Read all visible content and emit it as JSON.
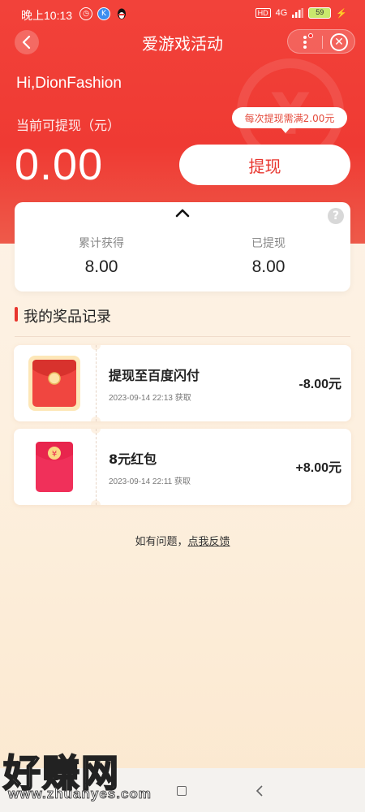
{
  "status_bar": {
    "time": "晚上10:13",
    "network": "4G",
    "battery": "59",
    "hd": "HD"
  },
  "title_bar": {
    "title": "爱游戏活动"
  },
  "account": {
    "greeting": "Hi,DionFashion",
    "balance_label": "当前可提现（元）",
    "balance_value": "0.00",
    "withdraw_tip": "每次提现需满2.00元",
    "withdraw_button": "提现"
  },
  "summary": {
    "earned_label": "累计获得",
    "earned_value": "8.00",
    "withdrawn_label": "已提现",
    "withdrawn_value": "8.00"
  },
  "records_section": {
    "title": "我的奖品记录",
    "items": [
      {
        "title": "提现至百度闪付",
        "time": "2023-09-14 22:13 获取",
        "amount": "-8.00元",
        "icon": "red-envelope-icon"
      },
      {
        "title": "8元红包",
        "time": "2023-09-14 22:11 获取",
        "amount": "+8.00元",
        "icon": "yuan-red-packet-icon"
      }
    ]
  },
  "feedback": {
    "prefix": "如有问题，",
    "link": "点我反馈"
  },
  "watermark": {
    "brand": "好赚网",
    "url": "www.zhuanyes.com"
  },
  "colors": {
    "primary_red": "#ef3a33",
    "accent_red": "#e8352e",
    "background": "#fdf0df"
  }
}
